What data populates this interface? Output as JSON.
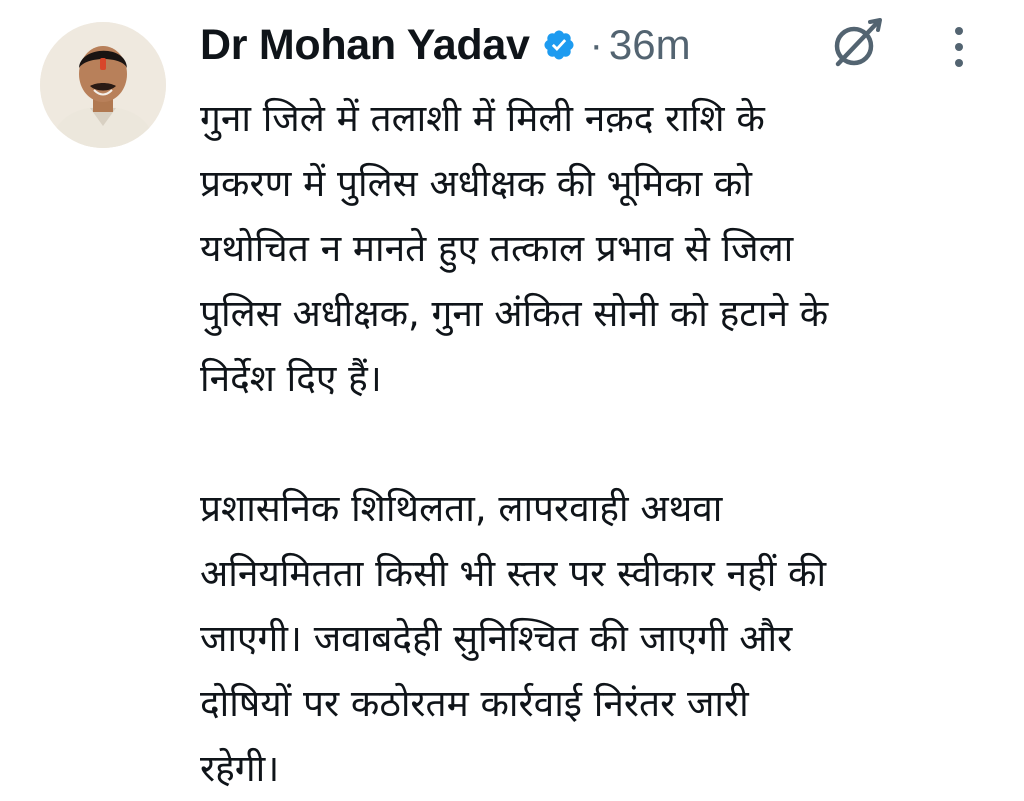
{
  "author": {
    "name": "Dr Mohan Yadav",
    "timestamp": "36m",
    "separator": "·"
  },
  "icons": {
    "verified": "verified-badge-icon",
    "grok": "grok-icon",
    "more": "more-options-icon"
  },
  "colors": {
    "verified": "#1d9bf0",
    "text": "#0f1419",
    "secondary": "#536471"
  },
  "tweet": {
    "paragraph1": [
      "गुना जिले में तलाशी में मिली नक़द राशि के",
      "प्रकरण में पुलिस अधीक्षक की भूमिका को",
      "यथोचित न मानते हुए तत्काल प्रभाव से जिला",
      "पुलिस अधीक्षक, गुना अंकित सोनी को हटाने के",
      "निर्देश दिए हैं।"
    ],
    "paragraph2": [
      "प्रशासनिक शिथिलता, लापरवाही अथवा",
      "अनियमितता किसी भी स्तर पर स्वीकार नहीं की",
      "जाएगी। जवाबदेही सुनिश्चित की जाएगी और",
      "दोषियों पर कठोरतम कार्रवाई निरंतर जारी",
      "रहेगी।"
    ]
  }
}
